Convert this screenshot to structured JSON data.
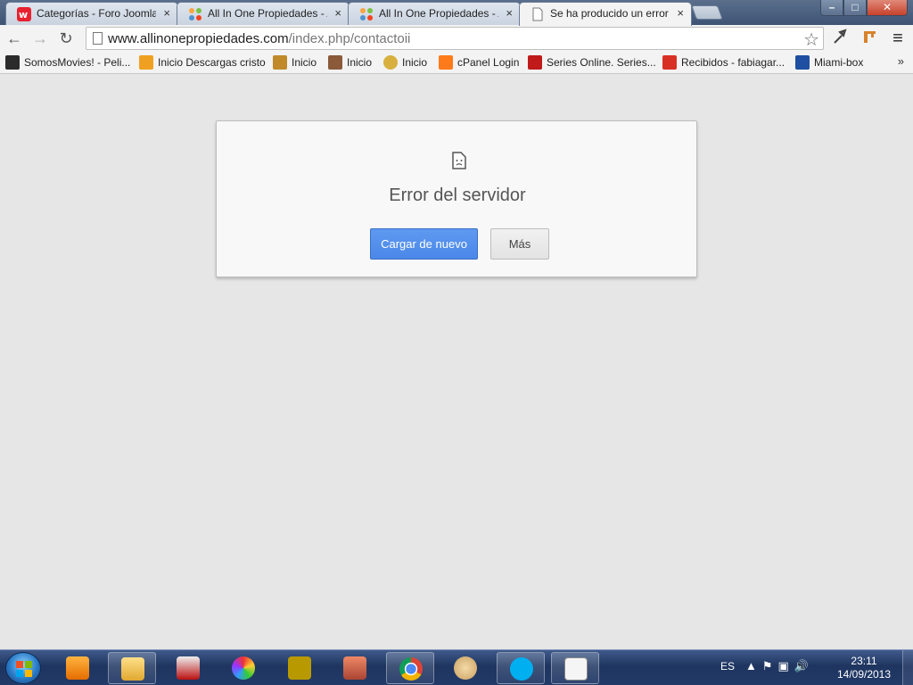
{
  "browser": {
    "tabs": [
      {
        "label": "Categorías - Foro Joomla!",
        "active": false,
        "favicon": "w-logo-icon"
      },
      {
        "label": "All In One Propiedades - A",
        "active": false,
        "favicon": "joomla-icon"
      },
      {
        "label": "All In One Propiedades - A",
        "active": false,
        "favicon": "joomla-icon"
      },
      {
        "label": "Se ha producido un error a",
        "active": true,
        "favicon": "page-icon"
      }
    ],
    "close_glyph": "×",
    "window": {
      "minimize": "–",
      "maximize": "□",
      "close": "✕"
    }
  },
  "toolbar": {
    "back": "←",
    "forward": "→",
    "reload": "↻",
    "url_host": "www.allinonepropiedades.com",
    "url_path": "/index.php/contactoii",
    "star": "☆",
    "menu": "≡"
  },
  "bookmarks": {
    "items": [
      {
        "label": "SomosMovies! - Peli...",
        "icon_color": "#2b2b2b"
      },
      {
        "label": "Inicio Descargas cristo",
        "icon_color": "#f0a020"
      },
      {
        "label": "Inicio",
        "icon_color": "#c08a2a"
      },
      {
        "label": "Inicio",
        "icon_color": "#8a5a3a"
      },
      {
        "label": "Inicio",
        "icon_color": "#d8b040"
      },
      {
        "label": "cPanel Login",
        "icon_color": "#ff7a1a"
      },
      {
        "label": "Series Online. Series...",
        "icon_color": "#c01a1a"
      },
      {
        "label": "Recibidos - fabiagar...",
        "icon_color": "#d93025"
      },
      {
        "label": "Miami-box",
        "icon_color": "#1f4fa0"
      }
    ],
    "more": "»"
  },
  "error": {
    "title": "Error del servidor",
    "reload_button": "Cargar de nuevo",
    "more_button": "Más"
  },
  "taskbar": {
    "language": "ES",
    "time": "23:11",
    "date": "14/09/2013",
    "apps": [
      "media-player-icon",
      "explorer-icon",
      "app-icon",
      "picasa-icon",
      "fireworks-icon",
      "app-icon",
      "chrome-icon",
      "paint-icon",
      "skype-icon",
      "app-icon"
    ]
  },
  "colors": {
    "primary_button": "#4a88e8",
    "page_bg": "#e6e6e6",
    "taskbar": "#1f3560"
  }
}
